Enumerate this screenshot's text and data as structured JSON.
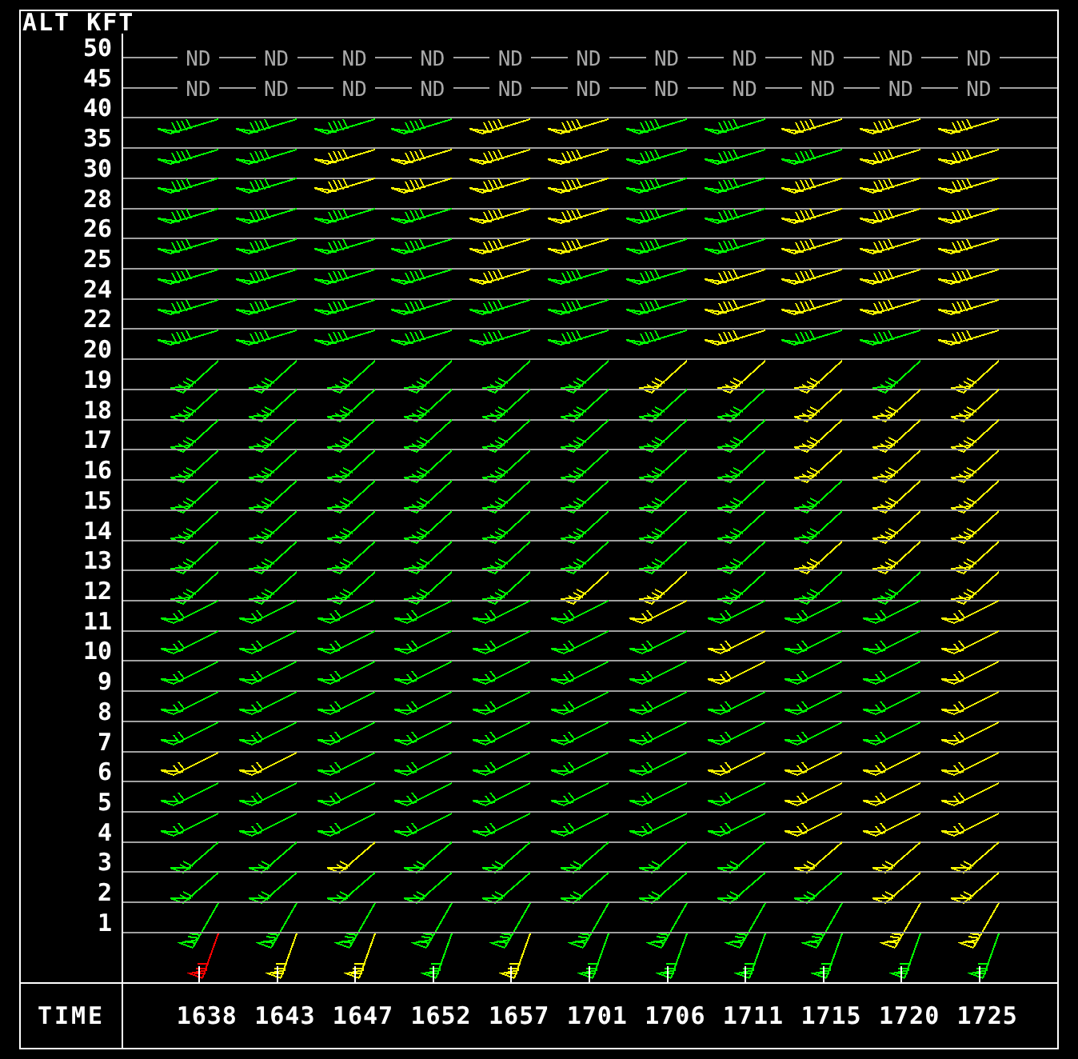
{
  "header": "ALT KFT",
  "levels": [
    {
      "altitude": "50",
      "kind": "nd",
      "cells": [
        "ND",
        "ND",
        "ND",
        "ND",
        "ND",
        "ND",
        "ND",
        "ND",
        "ND",
        "ND",
        "ND"
      ]
    },
    {
      "altitude": "45",
      "kind": "nd",
      "cells": [
        "ND",
        "ND",
        "ND",
        "ND",
        "ND",
        "ND",
        "ND",
        "ND",
        "ND",
        "ND",
        "ND"
      ]
    },
    {
      "altitude": "40",
      "kind": "barbs",
      "barbs": [
        {
          "color": "#00ff00"
        },
        {
          "color": "#00ff00"
        },
        {
          "color": "#00ff00"
        },
        {
          "color": "#00ff00"
        },
        {
          "color": "#ffff00"
        },
        {
          "color": "#ffff00"
        },
        {
          "color": "#00ff00"
        },
        {
          "color": "#00ff00"
        },
        {
          "color": "#ffff00"
        },
        {
          "color": "#ffff00"
        },
        {
          "color": "#ffff00"
        }
      ]
    },
    {
      "altitude": "35",
      "kind": "barbs",
      "barbs": [
        {
          "color": "#00ff00"
        },
        {
          "color": "#00ff00"
        },
        {
          "color": "#ffff00"
        },
        {
          "color": "#ffff00"
        },
        {
          "color": "#ffff00"
        },
        {
          "color": "#ffff00"
        },
        {
          "color": "#00ff00"
        },
        {
          "color": "#00ff00"
        },
        {
          "color": "#00ff00"
        },
        {
          "color": "#ffff00"
        },
        {
          "color": "#ffff00"
        }
      ]
    },
    {
      "altitude": "30",
      "kind": "barbs",
      "barbs": [
        {
          "color": "#00ff00"
        },
        {
          "color": "#00ff00"
        },
        {
          "color": "#ffff00"
        },
        {
          "color": "#ffff00"
        },
        {
          "color": "#ffff00"
        },
        {
          "color": "#ffff00"
        },
        {
          "color": "#00ff00"
        },
        {
          "color": "#00ff00"
        },
        {
          "color": "#ffff00"
        },
        {
          "color": "#ffff00"
        },
        {
          "color": "#ffff00"
        }
      ]
    },
    {
      "altitude": "28",
      "kind": "barbs",
      "barbs": [
        {
          "color": "#00ff00"
        },
        {
          "color": "#00ff00"
        },
        {
          "color": "#00ff00"
        },
        {
          "color": "#00ff00"
        },
        {
          "color": "#ffff00"
        },
        {
          "color": "#ffff00"
        },
        {
          "color": "#00ff00"
        },
        {
          "color": "#00ff00"
        },
        {
          "color": "#ffff00"
        },
        {
          "color": "#ffff00"
        },
        {
          "color": "#ffff00"
        }
      ]
    },
    {
      "altitude": "26",
      "kind": "barbs",
      "barbs": [
        {
          "color": "#00ff00"
        },
        {
          "color": "#00ff00"
        },
        {
          "color": "#00ff00"
        },
        {
          "color": "#00ff00"
        },
        {
          "color": "#ffff00"
        },
        {
          "color": "#ffff00"
        },
        {
          "color": "#00ff00"
        },
        {
          "color": "#00ff00"
        },
        {
          "color": "#ffff00"
        },
        {
          "color": "#ffff00"
        },
        {
          "color": "#ffff00"
        }
      ]
    },
    {
      "altitude": "25",
      "kind": "barbs",
      "barbs": [
        {
          "color": "#00ff00"
        },
        {
          "color": "#00ff00"
        },
        {
          "color": "#00ff00"
        },
        {
          "color": "#00ff00"
        },
        {
          "color": "#ffff00"
        },
        {
          "color": "#00ff00"
        },
        {
          "color": "#00ff00"
        },
        {
          "color": "#ffff00"
        },
        {
          "color": "#ffff00"
        },
        {
          "color": "#ffff00"
        },
        {
          "color": "#ffff00"
        }
      ]
    },
    {
      "altitude": "24",
      "kind": "barbs",
      "barbs": [
        {
          "color": "#00ff00"
        },
        {
          "color": "#00ff00"
        },
        {
          "color": "#00ff00"
        },
        {
          "color": "#00ff00"
        },
        {
          "color": "#00ff00"
        },
        {
          "color": "#00ff00"
        },
        {
          "color": "#00ff00"
        },
        {
          "color": "#ffff00"
        },
        {
          "color": "#ffff00"
        },
        {
          "color": "#ffff00"
        },
        {
          "color": "#ffff00"
        }
      ]
    },
    {
      "altitude": "22",
      "kind": "barbs",
      "barbs": [
        {
          "color": "#00ff00"
        },
        {
          "color": "#00ff00"
        },
        {
          "color": "#00ff00"
        },
        {
          "color": "#00ff00"
        },
        {
          "color": "#00ff00"
        },
        {
          "color": "#00ff00"
        },
        {
          "color": "#00ff00"
        },
        {
          "color": "#ffff00"
        },
        {
          "color": "#00ff00"
        },
        {
          "color": "#00ff00"
        },
        {
          "color": "#ffff00"
        }
      ]
    },
    {
      "altitude": "20",
      "kind": "barbs",
      "barbs": [
        {
          "color": "#00ff00"
        },
        {
          "color": "#00ff00"
        },
        {
          "color": "#00ff00"
        },
        {
          "color": "#00ff00"
        },
        {
          "color": "#00ff00"
        },
        {
          "color": "#00ff00"
        },
        {
          "color": "#ffff00"
        },
        {
          "color": "#ffff00"
        },
        {
          "color": "#ffff00"
        },
        {
          "color": "#00ff00"
        },
        {
          "color": "#ffff00"
        }
      ]
    },
    {
      "altitude": "19",
      "kind": "barbs",
      "barbs": [
        {
          "color": "#00ff00"
        },
        {
          "color": "#00ff00"
        },
        {
          "color": "#00ff00"
        },
        {
          "color": "#00ff00"
        },
        {
          "color": "#00ff00"
        },
        {
          "color": "#00ff00"
        },
        {
          "color": "#00ff00"
        },
        {
          "color": "#00ff00"
        },
        {
          "color": "#ffff00"
        },
        {
          "color": "#ffff00"
        },
        {
          "color": "#ffff00"
        }
      ]
    },
    {
      "altitude": "18",
      "kind": "barbs",
      "barbs": [
        {
          "color": "#00ff00"
        },
        {
          "color": "#00ff00"
        },
        {
          "color": "#00ff00"
        },
        {
          "color": "#00ff00"
        },
        {
          "color": "#00ff00"
        },
        {
          "color": "#00ff00"
        },
        {
          "color": "#00ff00"
        },
        {
          "color": "#00ff00"
        },
        {
          "color": "#ffff00"
        },
        {
          "color": "#ffff00"
        },
        {
          "color": "#ffff00"
        }
      ]
    },
    {
      "altitude": "17",
      "kind": "barbs",
      "barbs": [
        {
          "color": "#00ff00"
        },
        {
          "color": "#00ff00"
        },
        {
          "color": "#00ff00"
        },
        {
          "color": "#00ff00"
        },
        {
          "color": "#00ff00"
        },
        {
          "color": "#00ff00"
        },
        {
          "color": "#00ff00"
        },
        {
          "color": "#00ff00"
        },
        {
          "color": "#ffff00"
        },
        {
          "color": "#ffff00"
        },
        {
          "color": "#ffff00"
        }
      ]
    },
    {
      "altitude": "16",
      "kind": "barbs",
      "barbs": [
        {
          "color": "#00ff00"
        },
        {
          "color": "#00ff00"
        },
        {
          "color": "#00ff00"
        },
        {
          "color": "#00ff00"
        },
        {
          "color": "#00ff00"
        },
        {
          "color": "#00ff00"
        },
        {
          "color": "#00ff00"
        },
        {
          "color": "#00ff00"
        },
        {
          "color": "#00ff00"
        },
        {
          "color": "#ffff00"
        },
        {
          "color": "#ffff00"
        }
      ]
    },
    {
      "altitude": "15",
      "kind": "barbs",
      "barbs": [
        {
          "color": "#00ff00"
        },
        {
          "color": "#00ff00"
        },
        {
          "color": "#00ff00"
        },
        {
          "color": "#00ff00"
        },
        {
          "color": "#00ff00"
        },
        {
          "color": "#00ff00"
        },
        {
          "color": "#00ff00"
        },
        {
          "color": "#00ff00"
        },
        {
          "color": "#00ff00"
        },
        {
          "color": "#ffff00"
        },
        {
          "color": "#ffff00"
        }
      ]
    },
    {
      "altitude": "14",
      "kind": "barbs",
      "barbs": [
        {
          "color": "#00ff00"
        },
        {
          "color": "#00ff00"
        },
        {
          "color": "#00ff00"
        },
        {
          "color": "#00ff00"
        },
        {
          "color": "#00ff00"
        },
        {
          "color": "#00ff00"
        },
        {
          "color": "#00ff00"
        },
        {
          "color": "#00ff00"
        },
        {
          "color": "#ffff00"
        },
        {
          "color": "#ffff00"
        },
        {
          "color": "#ffff00"
        }
      ]
    },
    {
      "altitude": "13",
      "kind": "barbs",
      "barbs": [
        {
          "color": "#00ff00"
        },
        {
          "color": "#00ff00"
        },
        {
          "color": "#00ff00"
        },
        {
          "color": "#00ff00"
        },
        {
          "color": "#00ff00"
        },
        {
          "color": "#ffff00"
        },
        {
          "color": "#ffff00"
        },
        {
          "color": "#00ff00"
        },
        {
          "color": "#00ff00"
        },
        {
          "color": "#00ff00"
        },
        {
          "color": "#ffff00"
        }
      ]
    },
    {
      "altitude": "12",
      "kind": "barbs",
      "barbs": [
        {
          "color": "#00ff00"
        },
        {
          "color": "#00ff00"
        },
        {
          "color": "#00ff00"
        },
        {
          "color": "#00ff00"
        },
        {
          "color": "#00ff00"
        },
        {
          "color": "#00ff00"
        },
        {
          "color": "#ffff00"
        },
        {
          "color": "#00ff00"
        },
        {
          "color": "#00ff00"
        },
        {
          "color": "#00ff00"
        },
        {
          "color": "#ffff00"
        }
      ]
    },
    {
      "altitude": "11",
      "kind": "barbs",
      "barbs": [
        {
          "color": "#00ff00"
        },
        {
          "color": "#00ff00"
        },
        {
          "color": "#00ff00"
        },
        {
          "color": "#00ff00"
        },
        {
          "color": "#00ff00"
        },
        {
          "color": "#00ff00"
        },
        {
          "color": "#00ff00"
        },
        {
          "color": "#ffff00"
        },
        {
          "color": "#00ff00"
        },
        {
          "color": "#00ff00"
        },
        {
          "color": "#ffff00"
        }
      ]
    },
    {
      "altitude": "10",
      "kind": "barbs",
      "barbs": [
        {
          "color": "#00ff00"
        },
        {
          "color": "#00ff00"
        },
        {
          "color": "#00ff00"
        },
        {
          "color": "#00ff00"
        },
        {
          "color": "#00ff00"
        },
        {
          "color": "#00ff00"
        },
        {
          "color": "#00ff00"
        },
        {
          "color": "#ffff00"
        },
        {
          "color": "#00ff00"
        },
        {
          "color": "#00ff00"
        },
        {
          "color": "#ffff00"
        }
      ]
    },
    {
      "altitude": "9",
      "kind": "barbs",
      "barbs": [
        {
          "color": "#00ff00"
        },
        {
          "color": "#00ff00"
        },
        {
          "color": "#00ff00"
        },
        {
          "color": "#00ff00"
        },
        {
          "color": "#00ff00"
        },
        {
          "color": "#00ff00"
        },
        {
          "color": "#00ff00"
        },
        {
          "color": "#00ff00"
        },
        {
          "color": "#00ff00"
        },
        {
          "color": "#00ff00"
        },
        {
          "color": "#ffff00"
        }
      ]
    },
    {
      "altitude": "8",
      "kind": "barbs",
      "barbs": [
        {
          "color": "#00ff00"
        },
        {
          "color": "#00ff00"
        },
        {
          "color": "#00ff00"
        },
        {
          "color": "#00ff00"
        },
        {
          "color": "#00ff00"
        },
        {
          "color": "#00ff00"
        },
        {
          "color": "#00ff00"
        },
        {
          "color": "#00ff00"
        },
        {
          "color": "#00ff00"
        },
        {
          "color": "#00ff00"
        },
        {
          "color": "#ffff00"
        }
      ]
    },
    {
      "altitude": "7",
      "kind": "barbs",
      "barbs": [
        {
          "color": "#ffff00"
        },
        {
          "color": "#ffff00"
        },
        {
          "color": "#00ff00"
        },
        {
          "color": "#00ff00"
        },
        {
          "color": "#00ff00"
        },
        {
          "color": "#00ff00"
        },
        {
          "color": "#00ff00"
        },
        {
          "color": "#ffff00"
        },
        {
          "color": "#ffff00"
        },
        {
          "color": "#ffff00"
        },
        {
          "color": "#ffff00"
        }
      ]
    },
    {
      "altitude": "6",
      "kind": "barbs",
      "barbs": [
        {
          "color": "#00ff00"
        },
        {
          "color": "#00ff00"
        },
        {
          "color": "#00ff00"
        },
        {
          "color": "#00ff00"
        },
        {
          "color": "#00ff00"
        },
        {
          "color": "#00ff00"
        },
        {
          "color": "#00ff00"
        },
        {
          "color": "#00ff00"
        },
        {
          "color": "#ffff00"
        },
        {
          "color": "#ffff00"
        },
        {
          "color": "#ffff00"
        }
      ]
    },
    {
      "altitude": "5",
      "kind": "barbs",
      "barbs": [
        {
          "color": "#00ff00"
        },
        {
          "color": "#00ff00"
        },
        {
          "color": "#00ff00"
        },
        {
          "color": "#00ff00"
        },
        {
          "color": "#00ff00"
        },
        {
          "color": "#00ff00"
        },
        {
          "color": "#00ff00"
        },
        {
          "color": "#00ff00"
        },
        {
          "color": "#ffff00"
        },
        {
          "color": "#ffff00"
        },
        {
          "color": "#ffff00"
        }
      ]
    },
    {
      "altitude": "4",
      "kind": "barbs",
      "barbs": [
        {
          "color": "#00ff00"
        },
        {
          "color": "#00ff00"
        },
        {
          "color": "#ffff00"
        },
        {
          "color": "#00ff00"
        },
        {
          "color": "#00ff00"
        },
        {
          "color": "#00ff00"
        },
        {
          "color": "#00ff00"
        },
        {
          "color": "#00ff00"
        },
        {
          "color": "#ffff00"
        },
        {
          "color": "#ffff00"
        },
        {
          "color": "#ffff00"
        }
      ]
    },
    {
      "altitude": "3",
      "kind": "barbs",
      "barbs": [
        {
          "color": "#00ff00"
        },
        {
          "color": "#00ff00"
        },
        {
          "color": "#00ff00"
        },
        {
          "color": "#00ff00"
        },
        {
          "color": "#00ff00"
        },
        {
          "color": "#00ff00"
        },
        {
          "color": "#00ff00"
        },
        {
          "color": "#00ff00"
        },
        {
          "color": "#00ff00"
        },
        {
          "color": "#ffff00"
        },
        {
          "color": "#ffff00"
        }
      ]
    },
    {
      "altitude": "2",
      "kind": "barbs",
      "barbs": [
        {
          "color": "#00ff00"
        },
        {
          "color": "#00ff00"
        },
        {
          "color": "#00ff00"
        },
        {
          "color": "#00ff00"
        },
        {
          "color": "#00ff00"
        },
        {
          "color": "#00ff00"
        },
        {
          "color": "#00ff00"
        },
        {
          "color": "#00ff00"
        },
        {
          "color": "#00ff00"
        },
        {
          "color": "#ffff00"
        },
        {
          "color": "#ffff00"
        }
      ]
    },
    {
      "altitude": "1",
      "kind": "barbs",
      "barbs": [
        {
          "color": "#ff0000"
        },
        {
          "color": "#ffff00"
        },
        {
          "color": "#ffff00"
        },
        {
          "color": "#00ff00"
        },
        {
          "color": "#ffff00"
        },
        {
          "color": "#00ff00"
        },
        {
          "color": "#00ff00"
        },
        {
          "color": "#00ff00"
        },
        {
          "color": "#00ff00"
        },
        {
          "color": "#00ff00"
        },
        {
          "color": "#00ff00"
        }
      ]
    }
  ],
  "time_label": "TIME",
  "times": [
    "1638",
    "1643",
    "1647",
    "1652",
    "1657",
    "1701",
    "1706",
    "1711",
    "1715",
    "1720",
    "1725"
  ]
}
